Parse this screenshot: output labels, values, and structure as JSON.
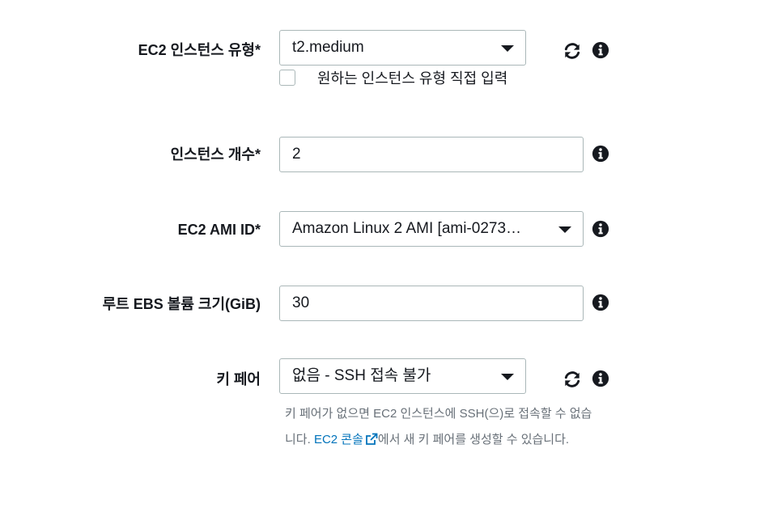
{
  "instance_type": {
    "label": "EC2 인스턴스 유형*",
    "value": "t2.medium",
    "custom_checkbox_label": "원하는 인스턴스 유형 직접 입력",
    "custom_checked": false
  },
  "instance_count": {
    "label": "인스턴스 개수*",
    "value": "2"
  },
  "ami": {
    "label": "EC2 AMI ID*",
    "value": "Amazon Linux 2 AMI [ami-0273…"
  },
  "root_volume": {
    "label": "루트 EBS 볼륨 크기(GiB)",
    "value": "30"
  },
  "key_pair": {
    "label": "키 페어",
    "value": "없음 - SSH 접속 불가",
    "help_part1": "키 페어가 없으면 EC2 인스턴스에 SSH(으)로 접속할 수 없습니다.",
    "help_link": "EC2 콘솔",
    "help_part2": "에서 새 키 페어를 생성할 수 있습니다."
  },
  "icons": {
    "refresh": "refresh-icon",
    "info": "info-icon",
    "external_link": "external-link-icon"
  },
  "colors": {
    "text": "#16191f",
    "border": "#aab7b8",
    "help_text": "#687078",
    "link": "#0073bb"
  }
}
